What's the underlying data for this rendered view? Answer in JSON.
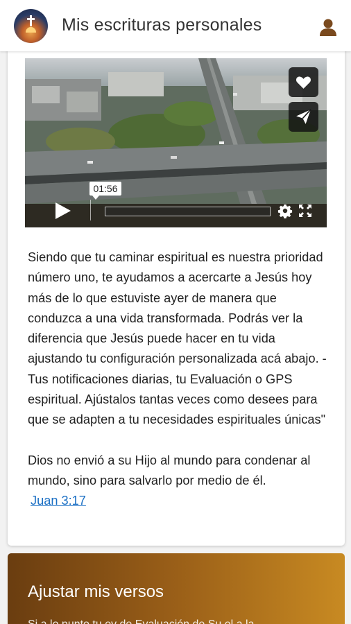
{
  "header": {
    "title": "Mis escrituras personales",
    "user_icon": "user-icon",
    "logo_icon": "app-logo"
  },
  "video": {
    "timestamp": "01:56",
    "progress": 0.0,
    "side_actions": [
      {
        "icon": "heart-icon",
        "label": "Me gusta"
      },
      {
        "icon": "send-icon",
        "label": "Compartir"
      }
    ],
    "controls": [
      "play-icon",
      "settings-icon",
      "fullscreen-icon"
    ]
  },
  "content": {
    "paragraph1": "Siendo que tu caminar espiritual es nuestra prioridad número uno, te ayudamos a acercarte a Jesús hoy más de lo que estuviste ayer de manera que conduzca a una vida transformada. Podrás ver la diferencia que Jesús puede hacer en tu vida ajustando tu configuración personalizada acá abajo. - Tus notificaciones diarias, tu Evaluación o GPS espiritual. Ajústalos tantas veces como desees para que se adapten a tu necesidades espirituales únicas\"",
    "verse_text": "Dios no envió a su Hijo al mundo para condenar al mundo, sino para salvarlo por medio de él.",
    "verse_reference": "Juan 3:17"
  },
  "adjust": {
    "title": "Ajustar mis versos",
    "subtitle": "Si a lo punto tu ev de Evaluación de Su el a la"
  },
  "colors": {
    "accent_link": "#1a6fc4",
    "card_gradient_start": "#6a3d10",
    "card_gradient_end": "#c88a22",
    "user_icon": "#7a4a1e"
  }
}
